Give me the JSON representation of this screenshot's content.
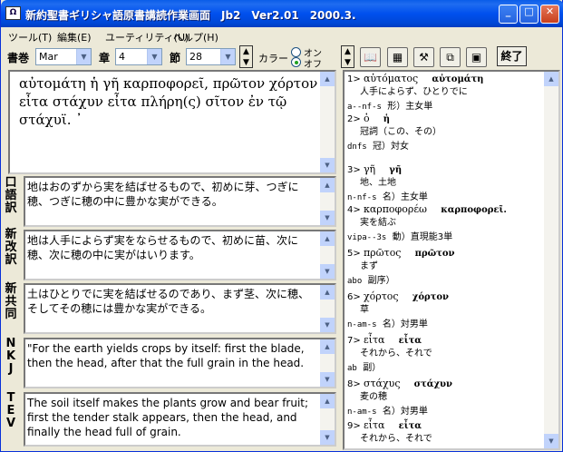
{
  "window": {
    "title": "新約聖書ギリシャ語原書講読作業画面　Jb2　Ver2.01　2000.3.",
    "icon": "app-icon",
    "min": "_",
    "max": "□",
    "close": "✕"
  },
  "menu": [
    "ツール(T)",
    "編集(E)",
    "ユーティリティ(U)",
    "ヘルプ(H)"
  ],
  "toolbar": {
    "book_label": "書巻",
    "book": "Mar",
    "chapter_label": "章",
    "chapter": "4",
    "verse_label": "節",
    "verse": "28",
    "color_label": "カラー",
    "on": "オン",
    "off": "オフ",
    "end": "終了"
  },
  "greek": "αὐτομάτη ἡ γῆ καρποφορεῖ, πρῶτον χόρτον εἶτα στάχυν εἶτα πλήρη(ς) σῖτον ἐν τῷ στάχυϊ. ᾽",
  "translations": [
    {
      "label": "口語訳",
      "text": "地はおのずから実を結ばせるもので、初めに芽、つぎに穂、つぎに穂の中に豊かな実ができる。"
    },
    {
      "label": "新改訳",
      "text": "地は人手によらず実をならせるもので、初めに苗、次に穂、次に穂の中に実がはいります。"
    },
    {
      "label": "新共同",
      "text": "土はひとりでに実を結ばせるのであり、まず茎、次に穂、そしてその穂には豊かな実ができる。"
    },
    {
      "label": "NKJ",
      "text": "\"For the earth yields crops by itself: first the blade, then the head, after that the full grain in the head."
    },
    {
      "label": "TEV",
      "text": "The soil itself makes the plants grow and bear fruit; first the tender stalk appears, then the head, and finally the head full of grain."
    }
  ],
  "lexicon": [
    {
      "n": "1>",
      "lemma": "αὐτόματος",
      "form": "αὐτομάτη",
      "gloss": "人手によらず、ひとりでに",
      "code": "a--nf-s",
      "pos": "形）主女単"
    },
    {
      "n": "2>",
      "lemma": "ὁ",
      "form": "ἡ",
      "gloss": "冠詞（この、その）",
      "code": "dnfs",
      "pos": "冠）対女"
    },
    {
      "n": "3>",
      "lemma": "γῆ",
      "form": "γῆ",
      "gloss": "地、土地",
      "code": "n-nf-s",
      "pos": "名）主女単"
    },
    {
      "n": "4>",
      "lemma": "καρποφορέω",
      "form": "καρποφορεῖ.",
      "gloss": "実を結ぶ",
      "code": "vipa--3s",
      "pos": "動）直現能3単"
    },
    {
      "n": "5>",
      "lemma": "πρῶτος",
      "form": "πρῶτον",
      "gloss": "まず",
      "code": "abo",
      "pos": "副序）"
    },
    {
      "n": "6>",
      "lemma": "χόρτος",
      "form": "χόρτον",
      "gloss": "草",
      "code": "n-am-s",
      "pos": "名）対男単"
    },
    {
      "n": "7>",
      "lemma": "εἶτα",
      "form": "εἶτα",
      "gloss": "それから、それで",
      "code": "ab",
      "pos": "副）"
    },
    {
      "n": "8>",
      "lemma": "στάχυς",
      "form": "στάχυν",
      "gloss": "麦の穂",
      "code": "n-am-s",
      "pos": "名）対男単"
    },
    {
      "n": "9>",
      "lemma": "εἶτα",
      "form": "εἶτα",
      "gloss": "それから、それで",
      "code": "",
      "pos": ""
    }
  ]
}
